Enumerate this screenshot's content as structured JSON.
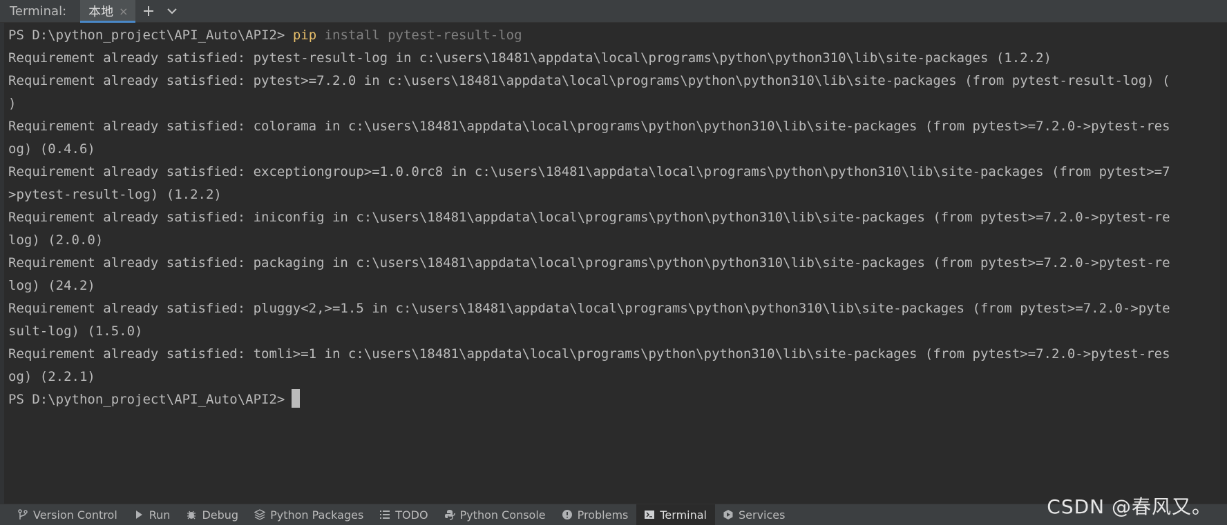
{
  "topbar": {
    "label": "Terminal:",
    "tab_label": "本地",
    "close_glyph": "×",
    "add_glyph": "+",
    "dropdown_glyph": "⌄"
  },
  "terminal": {
    "prompt_line": {
      "prompt": "PS D:\\python_project\\API_Auto\\API2> ",
      "command": "pip",
      "args": " install pytest-result-log"
    },
    "lines": [
      "Requirement already satisfied: pytest-result-log in c:\\users\\18481\\appdata\\local\\programs\\python\\python310\\lib\\site-packages (1.2.2)",
      "Requirement already satisfied: pytest>=7.2.0 in c:\\users\\18481\\appdata\\local\\programs\\python\\python310\\lib\\site-packages (from pytest-result-log) (",
      ")",
      "Requirement already satisfied: colorama in c:\\users\\18481\\appdata\\local\\programs\\python\\python310\\lib\\site-packages (from pytest>=7.2.0->pytest-res",
      "og) (0.4.6)",
      "Requirement already satisfied: exceptiongroup>=1.0.0rc8 in c:\\users\\18481\\appdata\\local\\programs\\python\\python310\\lib\\site-packages (from pytest>=7",
      ">pytest-result-log) (1.2.2)",
      "Requirement already satisfied: iniconfig in c:\\users\\18481\\appdata\\local\\programs\\python\\python310\\lib\\site-packages (from pytest>=7.2.0->pytest-re",
      "log) (2.0.0)",
      "Requirement already satisfied: packaging in c:\\users\\18481\\appdata\\local\\programs\\python\\python310\\lib\\site-packages (from pytest>=7.2.0->pytest-re",
      "log) (24.2)",
      "Requirement already satisfied: pluggy<2,>=1.5 in c:\\users\\18481\\appdata\\local\\programs\\python\\python310\\lib\\site-packages (from pytest>=7.2.0->pyte",
      "sult-log) (1.5.0)",
      "Requirement already satisfied: tomli>=1 in c:\\users\\18481\\appdata\\local\\programs\\python\\python310\\lib\\site-packages (from pytest>=7.2.0->pytest-res",
      "og) (2.2.1)"
    ],
    "final_prompt": "PS D:\\python_project\\API_Auto\\API2>"
  },
  "bottombar": {
    "items": [
      {
        "label": "Version Control",
        "icon": "version-control-icon"
      },
      {
        "label": "Run",
        "icon": "run-icon"
      },
      {
        "label": "Debug",
        "icon": "debug-icon"
      },
      {
        "label": "Python Packages",
        "icon": "packages-icon"
      },
      {
        "label": "TODO",
        "icon": "todo-icon"
      },
      {
        "label": "Python Console",
        "icon": "python-icon"
      },
      {
        "label": "Problems",
        "icon": "problems-icon"
      },
      {
        "label": "Terminal",
        "icon": "terminal-icon"
      },
      {
        "label": "Services",
        "icon": "services-icon"
      }
    ],
    "active": "Terminal"
  },
  "watermark": "CSDN @春风又。",
  "colors": {
    "background": "#2b2b2b",
    "toolbar": "#3c3f41",
    "text": "#bbbbbb",
    "command": "#e8bf6a",
    "tab_underline": "#4a88c7"
  }
}
